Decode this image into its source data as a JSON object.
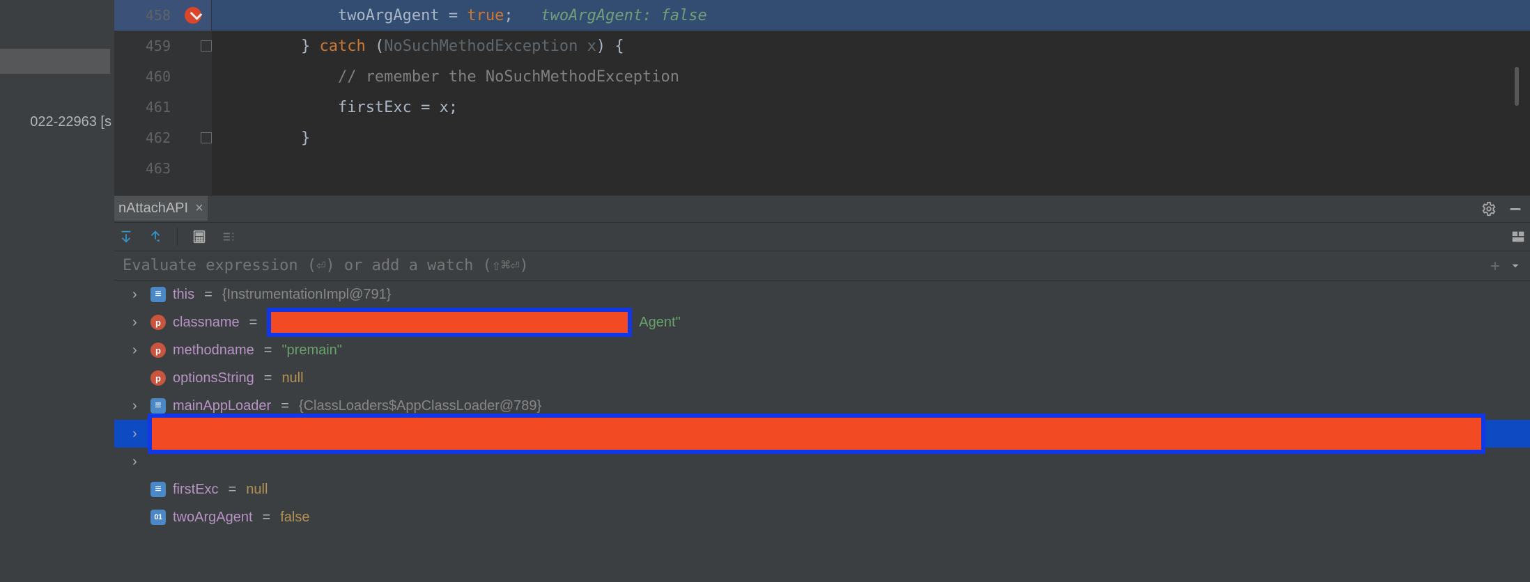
{
  "sidebar": {
    "project_label_fragment": "022-22963 [s"
  },
  "editor": {
    "lines": [
      {
        "num": "458",
        "breakpoint": true,
        "selected": true,
        "indent": "            ",
        "segments": [
          {
            "t": "ident",
            "v": "twoArgAgent "
          },
          {
            "t": "op",
            "v": "= "
          },
          {
            "t": "true",
            "v": "true"
          },
          {
            "t": "op",
            "v": ";   "
          },
          {
            "t": "hint",
            "v": "twoArgAgent: false"
          }
        ]
      },
      {
        "num": "459",
        "fold": true,
        "indent": "        ",
        "segments": [
          {
            "t": "op",
            "v": "} "
          },
          {
            "t": "kw",
            "v": "catch"
          },
          {
            "t": "op",
            "v": " ("
          },
          {
            "t": "dimexc",
            "v": "NoSuchMethodException x"
          },
          {
            "t": "op",
            "v": ") {"
          }
        ]
      },
      {
        "num": "460",
        "indent": "            ",
        "segments": [
          {
            "t": "cmt",
            "v": "// remember the NoSuchMethodException"
          }
        ]
      },
      {
        "num": "461",
        "indent": "            ",
        "segments": [
          {
            "t": "ident",
            "v": "firstExc "
          },
          {
            "t": "op",
            "v": "= x;"
          }
        ]
      },
      {
        "num": "462",
        "fold": true,
        "indent": "        ",
        "segments": [
          {
            "t": "op",
            "v": "}"
          }
        ]
      },
      {
        "num": "463",
        "indent": "",
        "segments": []
      }
    ]
  },
  "debug": {
    "tab_label": "nAttachAPI",
    "eval_placeholder": "Evaluate expression (⏎) or add a watch (⇧⌘⏎)",
    "variables": [
      {
        "expandable": true,
        "icon": "obj",
        "name": "this",
        "op": "=",
        "value": "{InstrumentationImpl@791}",
        "vclass": "v-val-obj"
      },
      {
        "expandable": true,
        "icon": "p",
        "name": "classname",
        "op": "=",
        "redact_before_value": true,
        "value": "Agent\"",
        "vclass": "v-val-str"
      },
      {
        "expandable": true,
        "icon": "p",
        "name": "methodname",
        "op": "=",
        "value": "\"premain\"",
        "vclass": "v-val-str"
      },
      {
        "expandable": false,
        "icon": "p",
        "name": "optionsString",
        "op": "=",
        "value": "null",
        "vclass": "v-val-kw"
      },
      {
        "expandable": true,
        "icon": "obj",
        "name": "mainAppLoader",
        "op": "=",
        "value": "{ClassLoaders$AppClassLoader@789}",
        "vclass": "v-val-obj"
      },
      {
        "expandable": true,
        "full_redact": true,
        "selected": true
      },
      {
        "expandable": true,
        "full_redact_tail": true
      },
      {
        "expandable": false,
        "icon": "obj",
        "name": "firstExc",
        "op": "=",
        "value": "null",
        "vclass": "v-val-kw"
      },
      {
        "expandable": false,
        "icon": "bool",
        "name": "twoArgAgent",
        "op": "=",
        "value": "false",
        "vclass": "v-val-kw"
      }
    ]
  }
}
